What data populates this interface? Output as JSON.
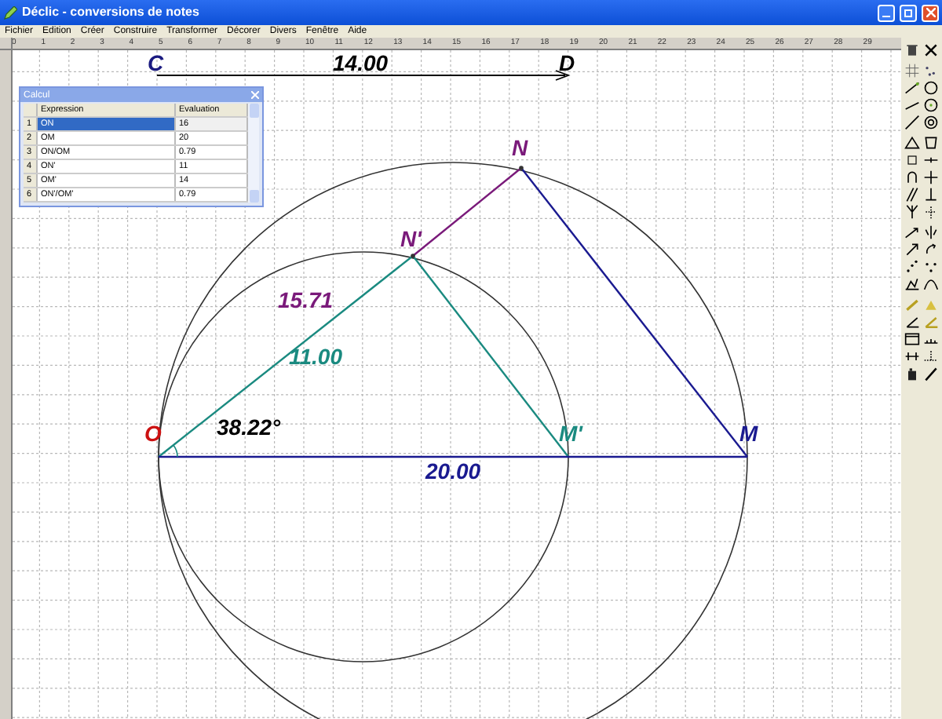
{
  "window": {
    "title": "Déclic - conversions de notes"
  },
  "menu": [
    "Fichier",
    "Edition",
    "Créer",
    "Construire",
    "Transformer",
    "Décorer",
    "Divers",
    "Fenêtre",
    "Aide"
  ],
  "ruler": {
    "labels": [
      "0",
      "1",
      "2",
      "3",
      "4",
      "5",
      "6",
      "7",
      "8",
      "9",
      "10",
      "11",
      "12",
      "13",
      "14",
      "15",
      "16",
      "17",
      "18",
      "19",
      "20",
      "21",
      "22",
      "23",
      "24",
      "25",
      "26",
      "27",
      "28",
      "29"
    ]
  },
  "calcul": {
    "title": "Calcul",
    "columns": [
      "Expression",
      "Evaluation"
    ],
    "rows": [
      {
        "index": "1",
        "expression": "ON",
        "evaluation": "16",
        "selected": true
      },
      {
        "index": "2",
        "expression": "OM",
        "evaluation": "20",
        "selected": false
      },
      {
        "index": "3",
        "expression": "ON/OM",
        "evaluation": "0.79",
        "selected": false
      },
      {
        "index": "4",
        "expression": "ON'",
        "evaluation": "11",
        "selected": false
      },
      {
        "index": "5",
        "expression": "OM'",
        "evaluation": "14",
        "selected": false
      },
      {
        "index": "6",
        "expression": "ON'/OM'",
        "evaluation": "0.79",
        "selected": false
      }
    ]
  },
  "figure": {
    "points": [
      {
        "label": "C",
        "color": "#1a1a80"
      },
      {
        "label": "D",
        "color": "#000000"
      },
      {
        "label": "N",
        "color": "#7a1a7a"
      },
      {
        "label": "N'",
        "color": "#7a1a7a"
      },
      {
        "label": "O",
        "color": "#cc1111"
      },
      {
        "label": "M'",
        "color": "#1a8a80"
      },
      {
        "label": "M",
        "color": "#1a1a90"
      }
    ],
    "measures": [
      {
        "text": "14.00",
        "color": "#000000"
      },
      {
        "text": "15.71",
        "color": "#7a1a7a"
      },
      {
        "text": "11.00",
        "color": "#1a8a80"
      },
      {
        "text": "38.22°",
        "color": "#000000"
      },
      {
        "text": "20.00",
        "color": "#1a1a90"
      }
    ]
  }
}
